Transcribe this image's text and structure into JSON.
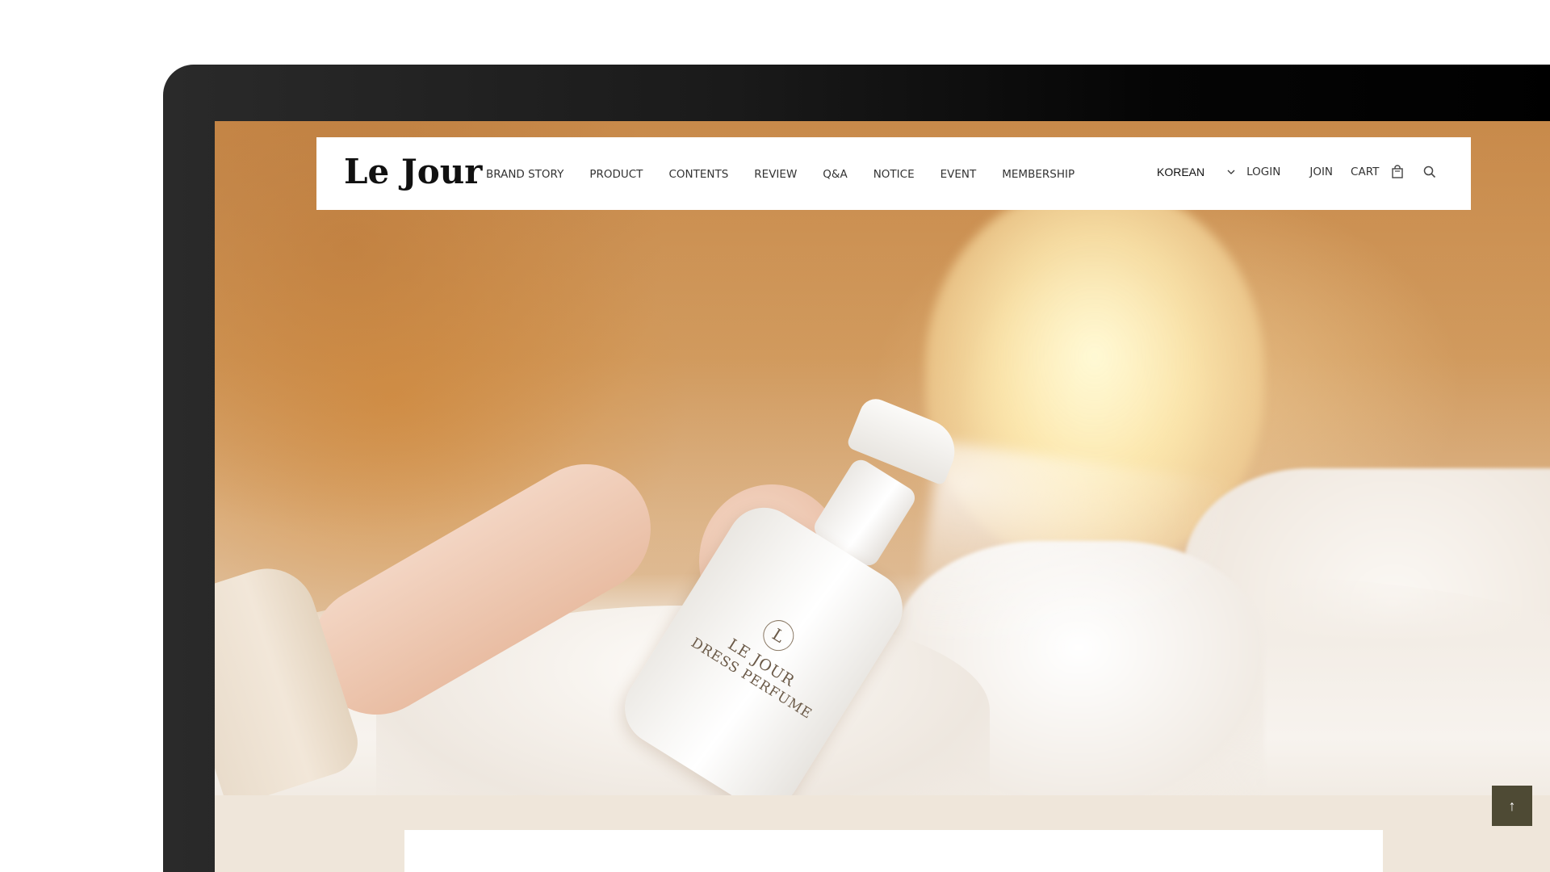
{
  "header": {
    "logo": "Le Jour",
    "menu": [
      "BRAND STORY",
      "PRODUCT",
      "CONTENTS",
      "REVIEW",
      "Q&A",
      "NOTICE",
      "EVENT",
      "MEMBERSHIP"
    ],
    "language": "KOREAN",
    "login_label": "LOGIN",
    "join_label": "JOIN",
    "cart_label": "CART"
  },
  "hero": {
    "bottle_mark": "L",
    "bottle_line1": "LE JOUR",
    "bottle_line2": "DRESS PERFUME"
  },
  "scroll_top": {
    "label": "↑"
  },
  "colors": {
    "top_button": "#4e4a34",
    "page_background": "#efe6da"
  },
  "icons": [
    "chevron-down-icon",
    "shopping-bag-icon",
    "search-icon",
    "arrow-up-icon"
  ]
}
